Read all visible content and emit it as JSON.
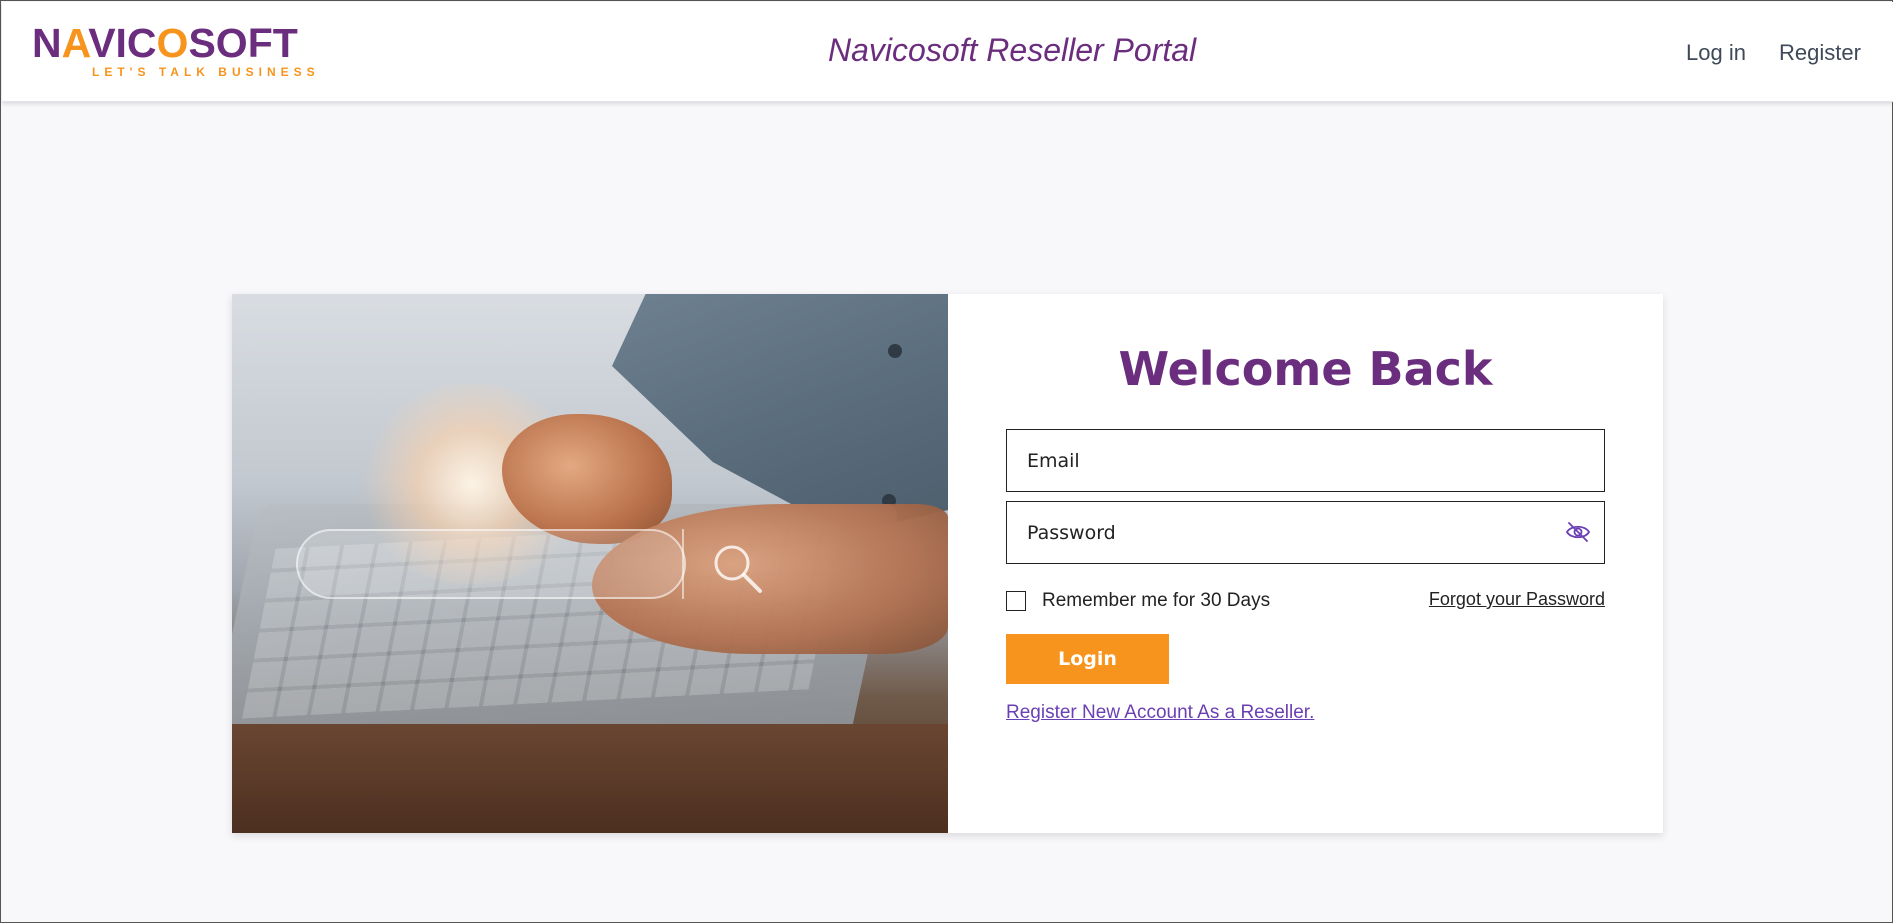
{
  "header": {
    "logo": {
      "word_parts": [
        "N",
        "A",
        "VIC",
        "O",
        "SOFT"
      ],
      "tagline": "LET'S TALK BUSINESS"
    },
    "title": "Navicosoft Reseller Portal",
    "nav": {
      "login": "Log in",
      "register": "Register"
    }
  },
  "hero": {
    "icon": "search-icon"
  },
  "form": {
    "heading": "Welcome Back",
    "email_placeholder": "Email",
    "password_placeholder": "Password",
    "password_toggle_icon": "eye-off-icon",
    "remember_label": "Remember me for 30 Days",
    "forgot_label": "Forgot your Password",
    "login_label": "Login",
    "register_label": "Register New Account As a Reseller."
  },
  "colors": {
    "brand_purple": "#6b2d7e",
    "brand_orange": "#f7941d",
    "link_purple": "#6a3fb3",
    "page_bg": "#f8f8fb"
  }
}
